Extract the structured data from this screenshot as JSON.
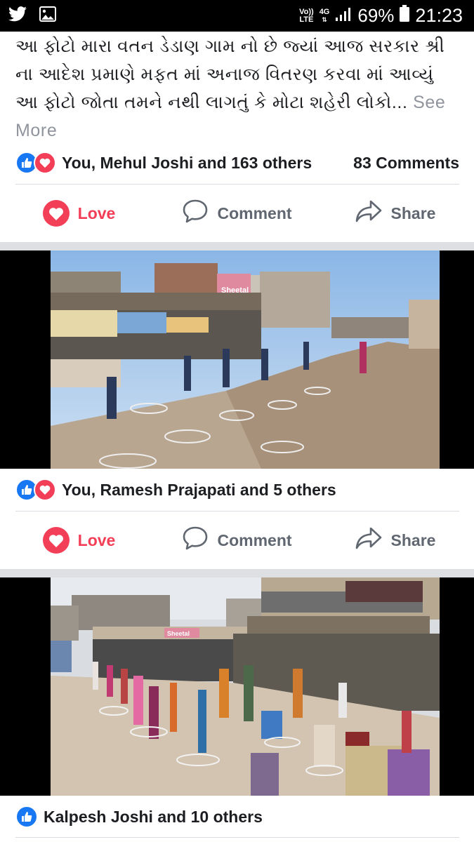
{
  "status_bar": {
    "volte_top": "Vo))",
    "volte_bottom": "LTE",
    "network": "4G",
    "battery_pct": "69%",
    "time": "21:23",
    "left_icons": [
      "twitter-icon",
      "gallery-icon"
    ]
  },
  "post1": {
    "text": "આ ફોટો મારા વતન ડેડાણ ગામ નો છે જ્યાં આજ સરકાર શ્રી ના આદેશ પ્રમાણે  મફત માં અનાજ વિતરણ કરવા માં આવ્યું આ ફોટો જોતા તમને નથી લાગતું કે મોટા શહેરી લોકો...",
    "see_more": "See More",
    "reactions": "You, Mehul Joshi and 163 others",
    "comments": "83 Comments"
  },
  "actions": {
    "love": "Love",
    "comment": "Comment",
    "share": "Share"
  },
  "post2": {
    "photo_sign": "Sheetal",
    "reactions": "You, Ramesh Prajapati and 5 others"
  },
  "post3": {
    "photo_sign": "Sheetal",
    "reactions": "Kalpesh Joshi and 10 others"
  },
  "colors": {
    "like_blue": "#1877f2",
    "love_red": "#f33e58",
    "text_grey": "#606770",
    "see_more_grey": "#90949c"
  }
}
